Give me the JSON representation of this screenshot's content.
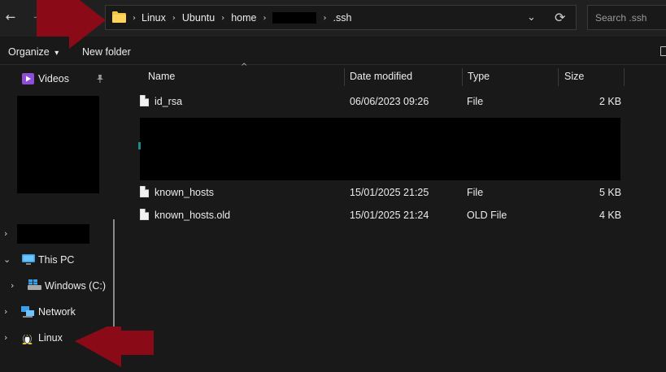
{
  "window": {
    "back_glyph": "←",
    "forward_glyph": "→",
    "recent_glyph": "⌄",
    "up_glyph": "↑"
  },
  "address": {
    "crumbs": [
      "Linux",
      "Ubuntu",
      "home",
      "",
      ".ssh"
    ],
    "chevron": "›",
    "dropdown_glyph": "⌄",
    "refresh_glyph": "⟳"
  },
  "search": {
    "placeholder": "Search .ssh"
  },
  "toolbar": {
    "organize_label": "Organize",
    "organize_caret": "▾",
    "new_folder_label": "New folder"
  },
  "sidebar": {
    "videos": "Videos",
    "this_pc": "This PC",
    "windows_c": "Windows (C:)",
    "network": "Network",
    "linux": "Linux"
  },
  "columns": {
    "name": "Name",
    "date": "Date modified",
    "type": "Type",
    "size": "Size",
    "sort_glyph": "^"
  },
  "files": [
    {
      "name": "id_rsa",
      "date": "06/06/2023 09:26",
      "type": "File",
      "size": "2 KB"
    },
    {
      "name": "known_hosts",
      "date": "15/01/2025 21:25",
      "type": "File",
      "size": "5 KB"
    },
    {
      "name": "known_hosts.old",
      "date": "15/01/2025 21:24",
      "type": "OLD File",
      "size": "4 KB"
    }
  ],
  "colors": {
    "annotation_arrow": "#8b0a17",
    "folder_yellow": "#f4c542",
    "background": "#191919"
  }
}
